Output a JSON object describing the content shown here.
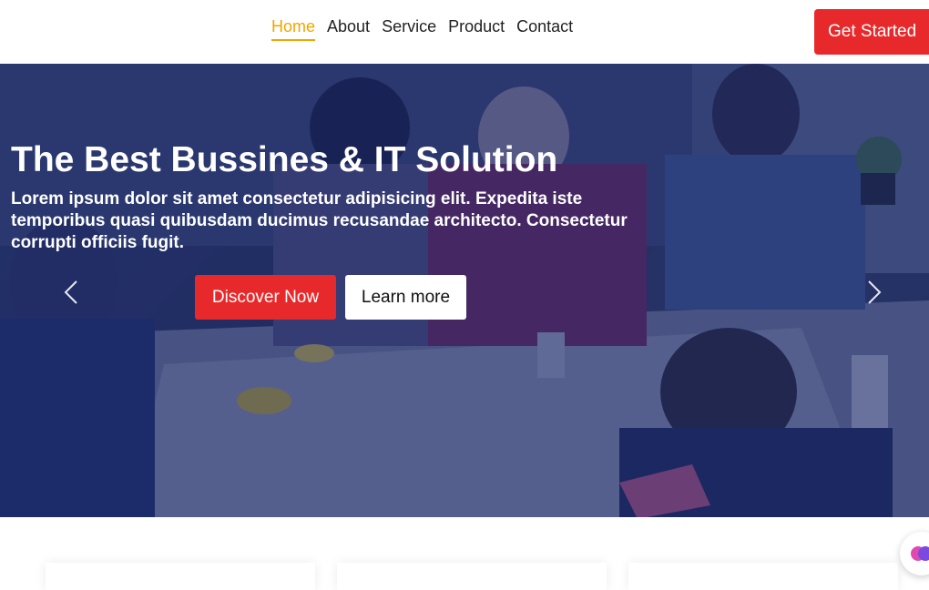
{
  "nav": {
    "items": [
      {
        "label": "Home",
        "active": true
      },
      {
        "label": "About",
        "active": false
      },
      {
        "label": "Service",
        "active": false
      },
      {
        "label": "Product",
        "active": false
      },
      {
        "label": "Contact",
        "active": false
      }
    ],
    "cta_label": "Get Started"
  },
  "hero": {
    "title": "The Best Bussines & IT Solution",
    "text": "Lorem ipsum dolor sit amet consectetur adipisicing elit. Expedita iste temporibus quasi quibusdam ducimus recusandae architecto. Consectetur corrupti officiis fugit.",
    "primary_button": "Discover Now",
    "secondary_button": "Learn more",
    "prev_icon": "chevron-left-icon",
    "next_icon": "chevron-right-icon"
  },
  "colors": {
    "accent": "#f0a500",
    "primary_red": "#e8292b",
    "overlay": "#1e2a66"
  },
  "widget": {
    "icon": "chat-widget-icon"
  }
}
